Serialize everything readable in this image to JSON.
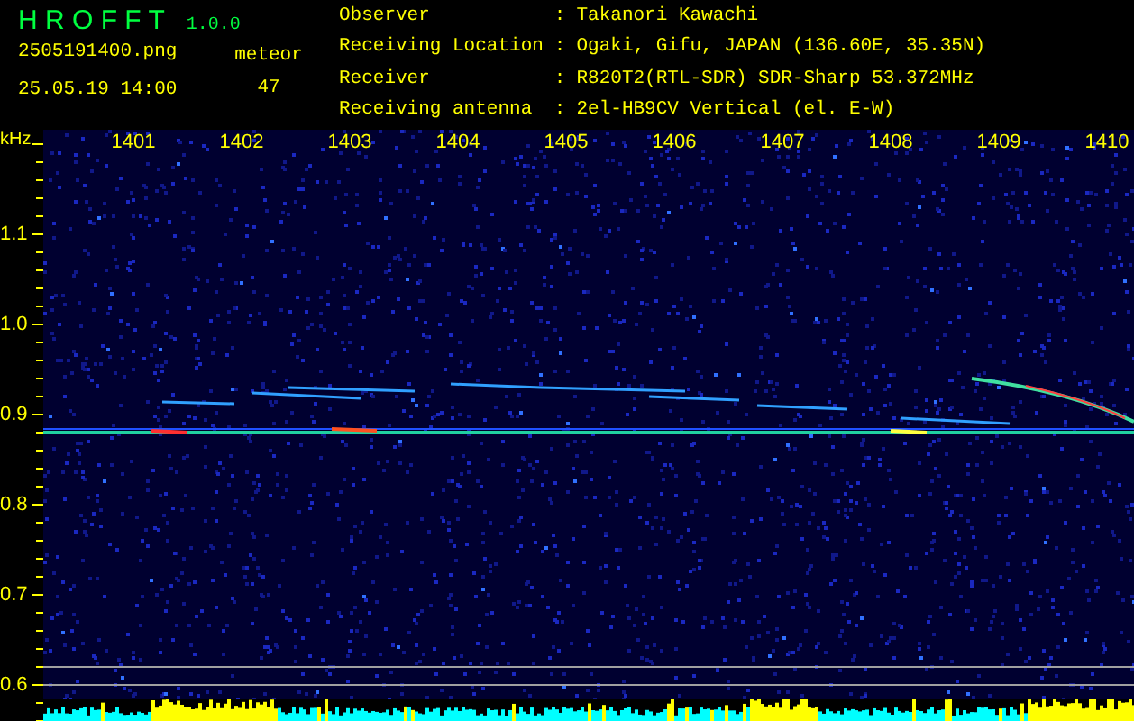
{
  "app": {
    "title": "H R O F F T",
    "version": "1.0.0"
  },
  "file": {
    "name": "2505191400.png",
    "timestamp": "25.05.19 14:00"
  },
  "counter": {
    "label": "meteor",
    "value": "47"
  },
  "station_info": [
    {
      "label": "Observer",
      "separator": ":",
      "value": "Takanori Kawachi"
    },
    {
      "label": "Receiving Location",
      "separator": ":",
      "value": "Ogaki, Gifu, JAPAN (136.60E, 35.35N)"
    },
    {
      "label": "Receiver",
      "separator": ":",
      "value": "R820T2(RTL-SDR) SDR-Sharp 53.372MHz"
    },
    {
      "label": "Receiving antenna",
      "separator": ":",
      "value": "2el-HB9CV Vertical (el. E-W)"
    }
  ],
  "spectrogram": {
    "unit": "kHz",
    "x_ticks": [
      "1401",
      "1402",
      "1403",
      "1404",
      "1405",
      "1406",
      "1407",
      "1408",
      "1409",
      "1410"
    ],
    "y_ticks": [
      "1.1",
      "1.0",
      "0.9",
      "0.8",
      "0.7",
      "0.6"
    ]
  }
}
